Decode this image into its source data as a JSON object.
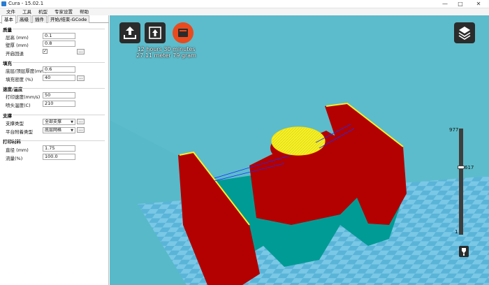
{
  "window": {
    "title": "Cura - 15.02.1",
    "minimize": "—",
    "maximize": "□",
    "close": "✕"
  },
  "menu": [
    "文件",
    "工具",
    "机型",
    "专家设置",
    "帮助"
  ],
  "tabs": [
    "基本",
    "高级",
    "插件",
    "开始/结束-GCode"
  ],
  "sections": {
    "quality": {
      "title": "质量",
      "layer_height_label": "层高 (mm)",
      "layer_height": "0.1",
      "wall_thickness_label": "壁厚 (mm)",
      "wall_thickness": "0.8",
      "retraction_label": "开启回退",
      "retraction_checked": true
    },
    "fill": {
      "title": "填充",
      "bottom_top_label": "底层/顶层厚度(mm)",
      "bottom_top": "0.6",
      "density_label": "填充密度 (%)",
      "density": "40"
    },
    "speed": {
      "title": "速度/温度",
      "print_speed_label": "打印速度(mm/s)",
      "print_speed": "50",
      "nozzle_temp_label": "喷头温度(C)",
      "nozzle_temp": "210"
    },
    "support": {
      "title": "支撑",
      "support_type_label": "支撑类型",
      "support_type": "全部支撑",
      "adhesion_label": "平台附着类型",
      "adhesion": "底层网格"
    },
    "filament": {
      "title": "打印材料",
      "diameter_label": "直径 (mm)",
      "diameter": "1.75",
      "flow_label": "流量(%)",
      "flow": "100.0"
    }
  },
  "dots_label": "...",
  "print_info": {
    "time": "12 hours 30 minutes",
    "material": "27.11 meter 79 gram"
  },
  "tool_buttons": {
    "load_icon": "load-model-icon",
    "save_icon": "save-toolpath-icon",
    "sd_icon": "sd-card-icon"
  },
  "layer_slider": {
    "max": "977",
    "current": "617",
    "min": "1",
    "level": 0.632
  },
  "colors": {
    "viewport": "#58b9c8",
    "model": "#b30000",
    "fill": "#f5f02a",
    "support": "#009b94",
    "accent": "#e94b1e"
  }
}
